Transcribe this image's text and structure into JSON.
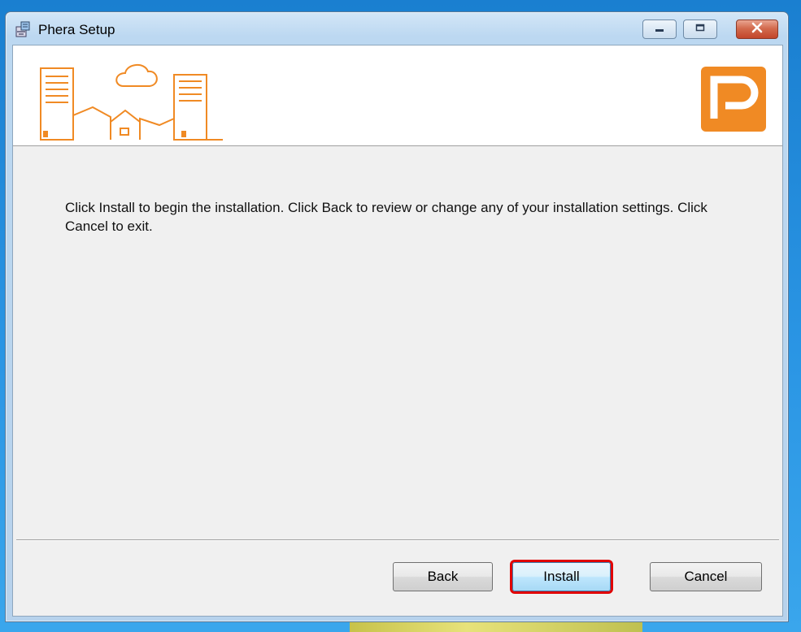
{
  "window": {
    "title": "Phera Setup",
    "controls": {
      "minimize": "minimize",
      "maximize": "maximize",
      "close": "close"
    }
  },
  "icons": {
    "app": "installer-icon",
    "banner": "city-skyline-illustration",
    "logo": "phera-logo"
  },
  "colors": {
    "brand_orange": "#f08a24",
    "highlight": "#e00000"
  },
  "content": {
    "message": "Click Install to begin the installation. Click Back to review or change any of your installation settings. Click Cancel to exit."
  },
  "buttons": {
    "back": "Back",
    "install": "Install",
    "cancel": "Cancel"
  }
}
